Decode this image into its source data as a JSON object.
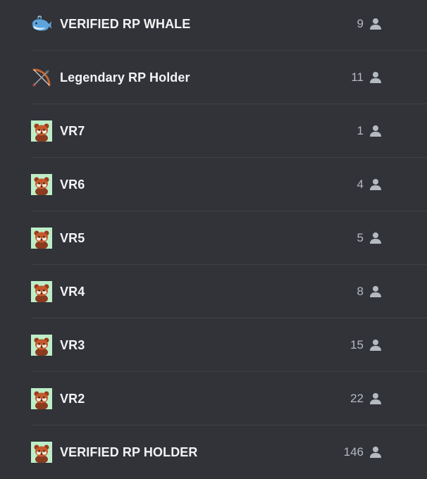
{
  "roles": [
    {
      "name": "VERIFIED RP WHALE",
      "count": "9",
      "icon": "whale-icon"
    },
    {
      "name": "Legendary RP Holder",
      "count": "11",
      "icon": "bow-and-arrow-icon"
    },
    {
      "name": "VR7",
      "count": "1",
      "icon": "red-panda-icon"
    },
    {
      "name": "VR6",
      "count": "4",
      "icon": "red-panda-icon"
    },
    {
      "name": "VR5",
      "count": "5",
      "icon": "red-panda-icon"
    },
    {
      "name": "VR4",
      "count": "8",
      "icon": "red-panda-icon"
    },
    {
      "name": "VR3",
      "count": "15",
      "icon": "red-panda-icon"
    },
    {
      "name": "VR2",
      "count": "22",
      "icon": "red-panda-icon"
    },
    {
      "name": "VERIFIED RP HOLDER",
      "count": "146",
      "icon": "red-panda-icon"
    }
  ],
  "colors": {
    "background": "#313338",
    "separator": "#3f4147",
    "text": "#f2f3f5",
    "muted": "#b5bac1",
    "panda_tile": "#bdeec7"
  }
}
